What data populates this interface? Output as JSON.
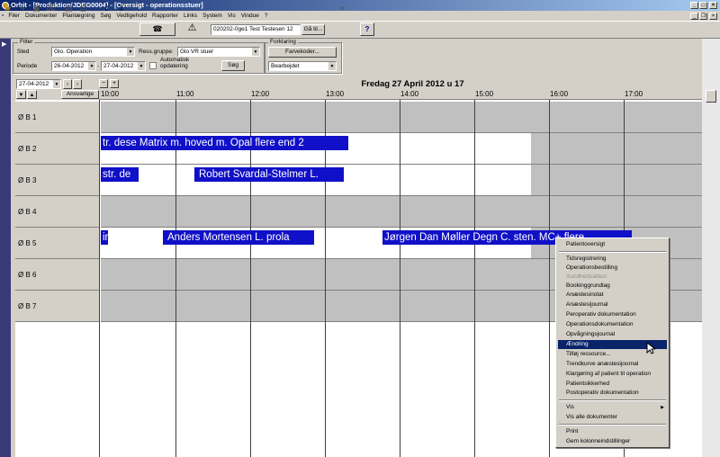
{
  "window": {
    "title": "Orbit - [Produktion/JDEG0004] - [Oversigt - operationsstuer]"
  },
  "menubar": [
    "Filer",
    "Dokumenter",
    "Planlægning",
    "Søg",
    "Vedligehold",
    "Rapporter",
    "Links",
    "System",
    "Vis",
    "Vindue",
    "?"
  ],
  "toolbar": {
    "patient_field": "020202-0ge1 Test Testesen 12",
    "goto_label": "Gå til..."
  },
  "filter": {
    "group_label": "Filter",
    "sted_label": "Sted",
    "sted_value": "Glo. Operation",
    "ress_label": "Ress.gruppe:",
    "ress_value": "Glo VR stuer",
    "periode_label": "Periode",
    "from": "26-04-2012",
    "to": "27-04-2012",
    "auto_label1": "Automatisk",
    "auto_label2": "opdatering",
    "search_button": "Søg"
  },
  "forklaring": {
    "group_label": "Forklaring",
    "colors_button": "Farvekoder...",
    "status_value": "Bearbejdet"
  },
  "schedule": {
    "date_field": "27-04-2012",
    "ansvarlige_label": "Ansvarlige",
    "header_title": "Fredag 27 April 2012 u 17",
    "hours": [
      "10:00",
      "11:00",
      "12:00",
      "13:00",
      "14:00",
      "15:00",
      "16:00",
      "17:00"
    ],
    "rows": [
      "Ø B 1",
      "Ø B 2",
      "Ø B 3",
      "Ø B 4",
      "Ø B 5",
      "Ø B 6",
      "Ø B 7"
    ],
    "bookings": [
      "tr. dese Matrix m. hoved m. Opal flere end 2",
      "str. de",
      "Robert Svardal-Stelmer L.",
      "ir",
      "Anders Mortensen L. prola",
      "Jørgen Dan Møller Degn C. sten. MC+ flere"
    ]
  },
  "context_menu": {
    "items": [
      "Patientoversigt",
      "Tidsregistrering",
      "Operationsbestilling",
      "Sundhedsattest",
      "Bookinggrundlag",
      "Anæstesinotat",
      "Anæstesijournal",
      "Peroperativ dokumentation",
      "Operationsdokumentation",
      "Opvågningsjournal",
      "Ændring",
      "Tilføj ressource...",
      "Trendkurve anæstesijournal",
      "Klargøring af patient til operation",
      "Patientsikkerhed",
      "Postoperativ dokumentation",
      "Vis",
      "Vis alle dokumenter",
      "Print",
      "Gem kolonneindstillinger"
    ],
    "selected": "Ændring",
    "disabled": "Sundhedsattest"
  }
}
